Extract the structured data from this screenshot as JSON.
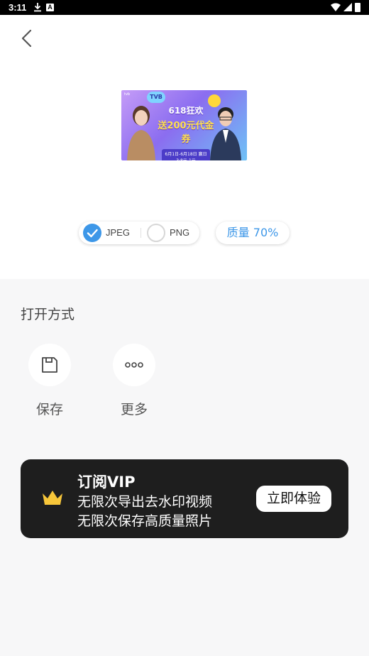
{
  "status_bar": {
    "time": "3:11",
    "a_badge": "A"
  },
  "preview": {
    "banner_headline": "618狂欢",
    "banner_offer": "送200元代金券",
    "banner_subtext": "6月1日-6月18日 赢日3·8元-1元",
    "banner_badge": "TVB",
    "banner_mini_logo": "tvb"
  },
  "format": {
    "options": [
      {
        "label": "JPEG",
        "selected": true
      },
      {
        "label": "PNG",
        "selected": false
      }
    ],
    "quality_label": "质量 70%"
  },
  "open_with": {
    "title": "打开方式",
    "actions": [
      {
        "label": "保存",
        "icon": "save-icon"
      },
      {
        "label": "更多",
        "icon": "more-icon"
      }
    ]
  },
  "vip": {
    "title": "订阅VIP",
    "line1": "无限次导出去水印视频",
    "line2": "无限次保存高质量照片",
    "cta": "立即体验",
    "icon": "crown-icon"
  },
  "colors": {
    "accent": "#3d97e8",
    "card_bg": "#1e1e1e",
    "crown": "#f7c63a",
    "page_bg": "#f7f7f8"
  }
}
